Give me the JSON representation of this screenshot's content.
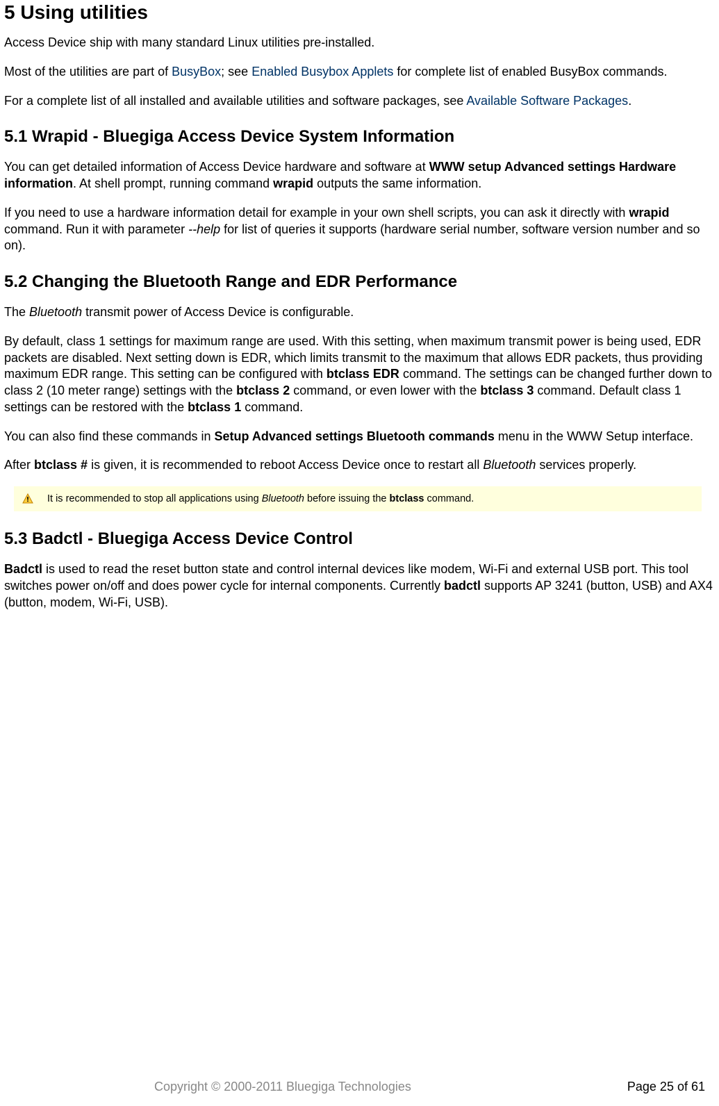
{
  "h1": "5 Using utilities",
  "p_intro": "Access Device ship with many standard Linux utilities pre-installed.",
  "p_busybox_1": "Most of the utilities are part of ",
  "link_busybox": "BusyBox",
  "p_busybox_2": "; see ",
  "link_applets": "Enabled Busybox Applets",
  "p_busybox_3": " for complete list of enabled BusyBox commands.",
  "p_pkgs_1": "For a complete list of all installed and available utilities and software packages, see ",
  "link_pkgs": "Available Software Packages",
  "p_pkgs_2": ".",
  "h2_51": "5.1 Wrapid - Bluegiga Access Device System Information",
  "p51a_1": "You can get detailed information of Access Device hardware and software at ",
  "p51a_b1": "WWW setup  Advanced settings  Hardware information",
  "p51a_2": ". At shell prompt, running command ",
  "p51a_b2": "wrapid",
  "p51a_3": " outputs the same information.",
  "p51b_1": "If you need to use a hardware information detail for example in your own shell scripts, you can ask it directly with ",
  "p51b_b1": "wrapid",
  "p51b_2": " command. Run it with parameter  ",
  "p51b_i1": "--help",
  "p51b_3": " for list of queries it supports (hardware serial number, software version number and so on).",
  "h2_52": "5.2 Changing the Bluetooth Range and EDR Performance",
  "p52a_1": "The ",
  "p52a_i1": "Bluetooth",
  "p52a_2": " transmit power of Access Device is configurable.",
  "p52b_1": "By default, class 1 settings for maximum range are used. With this setting, when maximum transmit power is being used, EDR packets are disabled. Next setting down is EDR, which limits transmit to the maximum that allows EDR packets, thus providing maximum EDR range. This setting can be configured with ",
  "p52b_b1": "btclass EDR",
  "p52b_2": " command. The settings can be changed further down to class 2 (10 meter range) settings with the ",
  "p52b_b2": "btclass 2",
  "p52b_3": " command, or even lower with the ",
  "p52b_b3": "btclass 3",
  "p52b_4": " command. Default class 1 settings can be restored with the ",
  "p52b_b4": "btclass 1",
  "p52b_5": " command.",
  "p52c_1": "You can also find these commands in ",
  "p52c_b1": "Setup  Advanced settings  Bluetooth commands",
  "p52c_2": " menu in the WWW Setup interface.",
  "p52d_1": "After ",
  "p52d_b1": "btclass #",
  "p52d_2": " is given, it is recommended to reboot Access Device once to restart all ",
  "p52d_i1": "Bluetooth",
  "p52d_3": " services properly.",
  "note_1": "It is recommended to stop all applications using ",
  "note_i1": "Bluetooth",
  "note_2": " before issuing the ",
  "note_b1": "btclass",
  "note_3": " command.",
  "h2_53": "5.3 Badctl - Bluegiga Access Device Control",
  "p53_b1": "Badctl",
  "p53_1": " is used to read the reset button state and control internal devices like modem, Wi-Fi and external USB port. This tool switches power on/off and does power cycle for internal components. Currently ",
  "p53_b2": "badctl",
  "p53_2": " supports AP 3241 (button, USB) and AX4 (button, modem, Wi-Fi, USB).",
  "footer_copy": "Copyright © 2000-2011 Bluegiga Technologies",
  "footer_page": "Page 25 of 61"
}
